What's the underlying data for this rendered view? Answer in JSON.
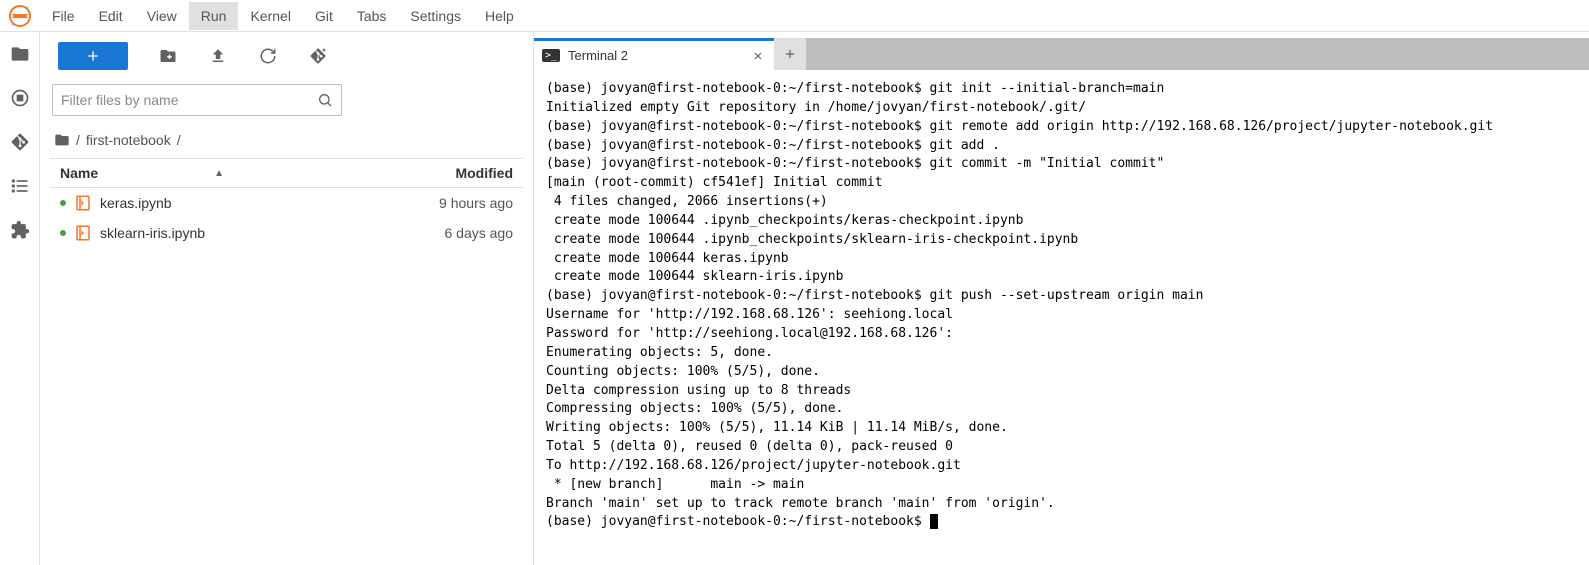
{
  "menu": {
    "items": [
      "File",
      "Edit",
      "View",
      "Run",
      "Kernel",
      "Git",
      "Tabs",
      "Settings",
      "Help"
    ],
    "hover_index": 3
  },
  "filebrowser": {
    "filter_placeholder": "Filter files by name",
    "breadcrumb_root": "/",
    "breadcrumb_folder": "first-notebook",
    "breadcrumb_trail": "/",
    "header_name": "Name",
    "header_modified": "Modified",
    "rows": [
      {
        "name": "keras.ipynb",
        "modified": "9 hours ago"
      },
      {
        "name": "sklearn-iris.ipynb",
        "modified": "6 days ago"
      }
    ]
  },
  "tab": {
    "badge": ">_",
    "title": "Terminal 2"
  },
  "terminal_lines": [
    "(base) jovyan@first-notebook-0:~/first-notebook$ git init --initial-branch=main",
    "Initialized empty Git repository in /home/jovyan/first-notebook/.git/",
    "(base) jovyan@first-notebook-0:~/first-notebook$ git remote add origin http://192.168.68.126/project/jupyter-notebook.git",
    "(base) jovyan@first-notebook-0:~/first-notebook$ git add .",
    "(base) jovyan@first-notebook-0:~/first-notebook$ git commit -m \"Initial commit\"",
    "[main (root-commit) cf541ef] Initial commit",
    " 4 files changed, 2066 insertions(+)",
    " create mode 100644 .ipynb_checkpoints/keras-checkpoint.ipynb",
    " create mode 100644 .ipynb_checkpoints/sklearn-iris-checkpoint.ipynb",
    " create mode 100644 keras.ipynb",
    " create mode 100644 sklearn-iris.ipynb",
    "(base) jovyan@first-notebook-0:~/first-notebook$ git push --set-upstream origin main",
    "Username for 'http://192.168.68.126': seehiong.local",
    "Password for 'http://seehiong.local@192.168.68.126':",
    "Enumerating objects: 5, done.",
    "Counting objects: 100% (5/5), done.",
    "Delta compression using up to 8 threads",
    "Compressing objects: 100% (5/5), done.",
    "Writing objects: 100% (5/5), 11.14 KiB | 11.14 MiB/s, done.",
    "Total 5 (delta 0), reused 0 (delta 0), pack-reused 0",
    "To http://192.168.68.126/project/jupyter-notebook.git",
    " * [new branch]      main -> main",
    "Branch 'main' set up to track remote branch 'main' from 'origin'.",
    "(base) jovyan@first-notebook-0:~/first-notebook$ "
  ]
}
